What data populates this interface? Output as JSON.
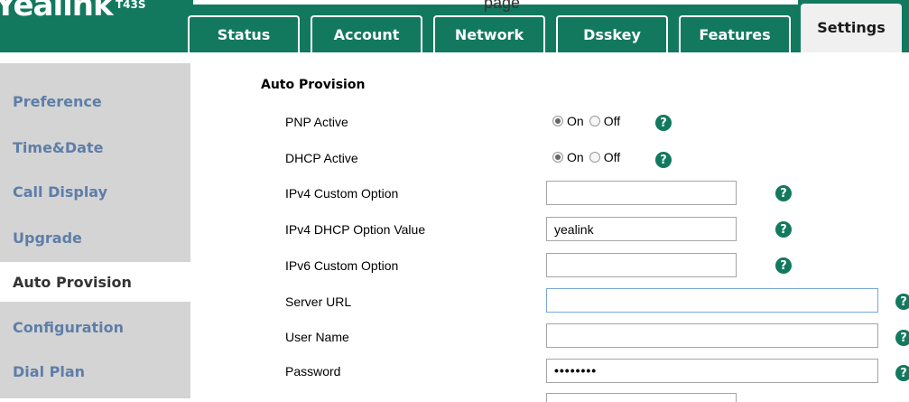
{
  "header": {
    "logo_text": "Yealink",
    "model": "T43S",
    "top_text": "page"
  },
  "tabs": [
    {
      "label": "Status"
    },
    {
      "label": "Account"
    },
    {
      "label": "Network"
    },
    {
      "label": "Dsskey"
    },
    {
      "label": "Features"
    },
    {
      "label": "Settings",
      "active": true
    }
  ],
  "sidebar": {
    "items": [
      {
        "label": "Preference"
      },
      {
        "label": "Time&Date"
      },
      {
        "label": "Call Display"
      },
      {
        "label": "Upgrade"
      },
      {
        "label": "Auto Provision",
        "active": true
      },
      {
        "label": "Configuration"
      },
      {
        "label": "Dial Plan"
      }
    ]
  },
  "main": {
    "section_title": "Auto Provision",
    "rows": [
      {
        "label": "PNP Active",
        "type": "radio",
        "options": [
          "On",
          "Off"
        ],
        "selected": "On"
      },
      {
        "label": "DHCP Active",
        "type": "radio",
        "options": [
          "On",
          "Off"
        ],
        "selected": "On"
      },
      {
        "label": "IPv4 Custom Option",
        "type": "text",
        "value": ""
      },
      {
        "label": "IPv4 DHCP Option Value",
        "type": "text",
        "value": "yealink"
      },
      {
        "label": "IPv6 Custom Option",
        "type": "text",
        "value": ""
      },
      {
        "label": "Server URL",
        "type": "text",
        "value": ""
      },
      {
        "label": "User Name",
        "type": "text",
        "value": ""
      },
      {
        "label": "Password",
        "type": "password",
        "value": "••••••••"
      }
    ],
    "help_glyph": "?"
  },
  "colors": {
    "brand_green": "#12795f",
    "sidebar_bg": "#d4d4d4",
    "sidebar_link": "#5e7ea8"
  }
}
